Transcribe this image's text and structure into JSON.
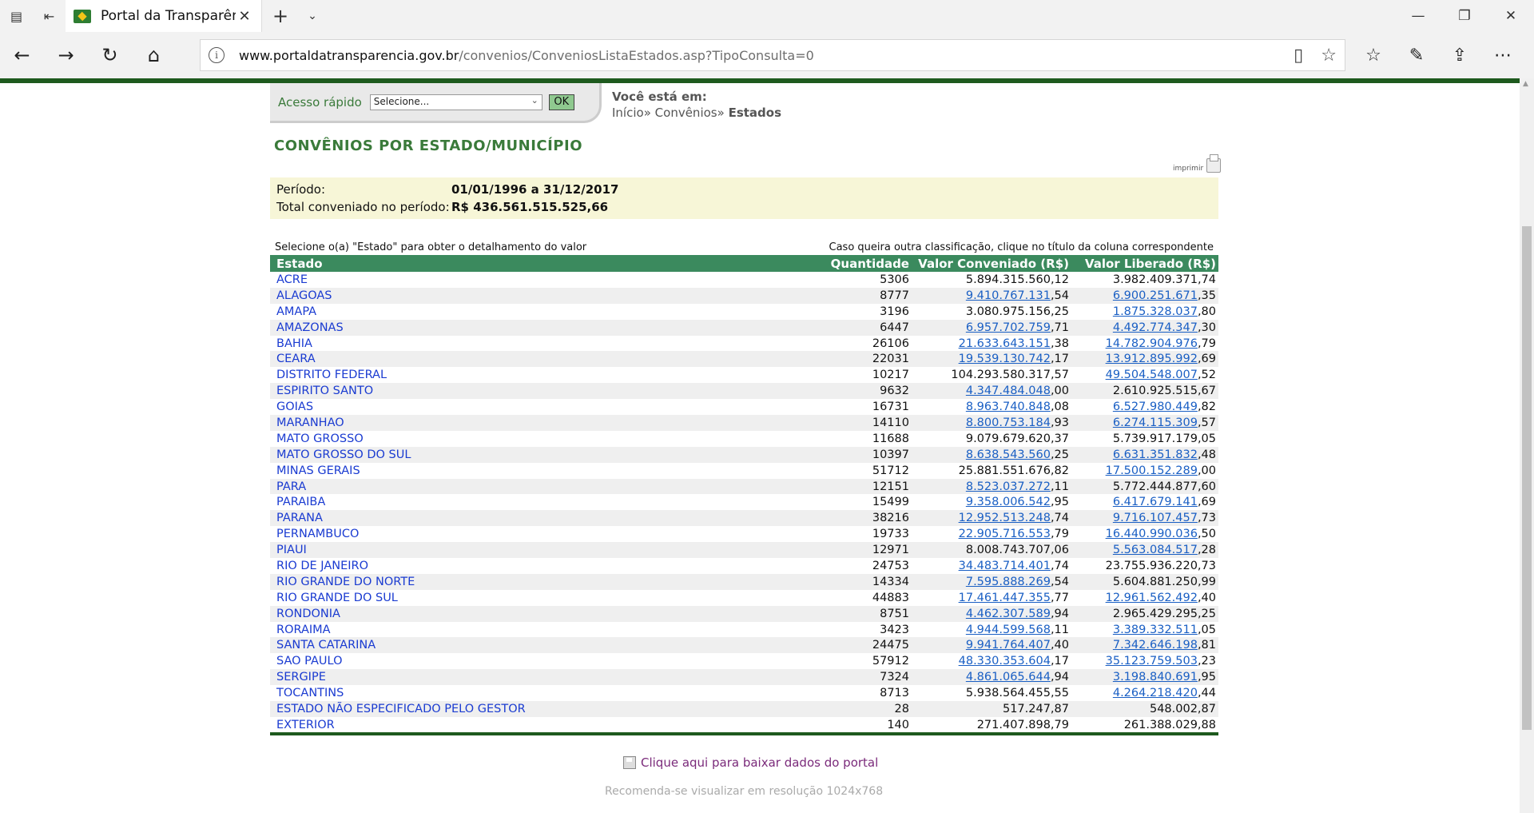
{
  "browser": {
    "tab_title": "Portal da Transparência",
    "url_host": "www.portaldatransparencia.gov.br",
    "url_path": "/convenios/ConveniosListaEstados.asp?TipoConsulta=0",
    "icons": [
      "tab-actions-icon",
      "back-tabs-icon",
      "close-icon",
      "new-tab-icon",
      "tab-list-icon",
      "back-icon",
      "forward-icon",
      "refresh-icon",
      "home-icon",
      "info-icon",
      "reading-view-icon",
      "favorite-star-icon",
      "favorites-hub-icon",
      "pen-icon",
      "share-icon",
      "more-icon"
    ]
  },
  "quick_access": {
    "label": "Acesso rápido",
    "select_value": "Selecione...",
    "ok_label": "OK"
  },
  "breadcrumb": {
    "label": "Você está em:",
    "home": "Início",
    "sep1": "»",
    "convenios": "Convênios",
    "sep2": "»",
    "current": "Estados"
  },
  "page_title": "CONVÊNIOS POR ESTADO/MUNICÍPIO",
  "print_label": "imprimir",
  "period": {
    "label": "Período:",
    "value": "01/01/1996 a 31/12/2017",
    "total_label": "Total conveniado no período:",
    "total_value": "R$ 436.561.515.525,66"
  },
  "hint_left": "Selecione o(a) \"Estado\" para obter o detalhamento do valor",
  "hint_right": "Caso queira outra classificação, clique no título da coluna correspondente",
  "table": {
    "headers": [
      "Estado",
      "Quantidade",
      "Valor Conveniado (R$)",
      "Valor Liberado (R$)"
    ],
    "rows": [
      [
        "ACRE",
        "5306",
        "5.894.315.560,12",
        "3.982.409.371,74"
      ],
      [
        "ALAGOAS",
        "8777",
        "9.410.767.131,54",
        "6.900.251.671,35"
      ],
      [
        "AMAPA",
        "3196",
        "3.080.975.156,25",
        "1.875.328.037,80"
      ],
      [
        "AMAZONAS",
        "6447",
        "6.957.702.759,71",
        "4.492.774.347,30"
      ],
      [
        "BAHIA",
        "26106",
        "21.633.643.151,38",
        "14.782.904.976,79"
      ],
      [
        "CEARA",
        "22031",
        "19.539.130.742,17",
        "13.912.895.992,69"
      ],
      [
        "DISTRITO FEDERAL",
        "10217",
        "104.293.580.317,57",
        "49.504.548.007,52"
      ],
      [
        "ESPIRITO SANTO",
        "9632",
        "4.347.484.048,00",
        "2.610.925.515,67"
      ],
      [
        "GOIAS",
        "16731",
        "8.963.740.848,08",
        "6.527.980.449,82"
      ],
      [
        "MARANHAO",
        "14110",
        "8.800.753.184,93",
        "6.274.115.309,57"
      ],
      [
        "MATO GROSSO",
        "11688",
        "9.079.679.620,37",
        "5.739.917.179,05"
      ],
      [
        "MATO GROSSO DO SUL",
        "10397",
        "8.638.543.560,25",
        "6.631.351.832,48"
      ],
      [
        "MINAS GERAIS",
        "51712",
        "25.881.551.676,82",
        "17.500.152.289,00"
      ],
      [
        "PARA",
        "12151",
        "8.523.037.272,11",
        "5.772.444.877,60"
      ],
      [
        "PARAIBA",
        "15499",
        "9.358.006.542,95",
        "6.417.679.141,69"
      ],
      [
        "PARANA",
        "38216",
        "12.952.513.248,74",
        "9.716.107.457,73"
      ],
      [
        "PERNAMBUCO",
        "19733",
        "22.905.716.553,79",
        "16.440.990.036,50"
      ],
      [
        "PIAUI",
        "12971",
        "8.008.743.707,06",
        "5.563.084.517,28"
      ],
      [
        "RIO DE JANEIRO",
        "24753",
        "34.483.714.401,74",
        "23.755.936.220,73"
      ],
      [
        "RIO GRANDE DO NORTE",
        "14334",
        "7.595.888.269,54",
        "5.604.881.250,99"
      ],
      [
        "RIO GRANDE DO SUL",
        "44883",
        "17.461.447.355,77",
        "12.961.562.492,40"
      ],
      [
        "RONDONIA",
        "8751",
        "4.462.307.589,94",
        "2.965.429.295,25"
      ],
      [
        "RORAIMA",
        "3423",
        "4.944.599.568,11",
        "3.389.332.511,05"
      ],
      [
        "SANTA CATARINA",
        "24475",
        "9.941.764.407,40",
        "7.342.646.198,81"
      ],
      [
        "SAO PAULO",
        "57912",
        "48.330.353.604,17",
        "35.123.759.503,23"
      ],
      [
        "SERGIPE",
        "7324",
        "4.861.065.644,94",
        "3.198.840.691,95"
      ],
      [
        "TOCANTINS",
        "8713",
        "5.938.564.455,55",
        "4.264.218.420,44"
      ],
      [
        "ESTADO NÃO ESPECIFICADO PELO GESTOR",
        "28",
        "517.247,87",
        "548.002,87"
      ],
      [
        "EXTERIOR",
        "140",
        "271.407.898,79",
        "261.388.029,88"
      ]
    ],
    "linked_conveniado": [
      false,
      true,
      false,
      true,
      true,
      true,
      false,
      true,
      true,
      true,
      false,
      true,
      false,
      true,
      true,
      true,
      true,
      false,
      true,
      true,
      true,
      true,
      true,
      true,
      true,
      true,
      false,
      false,
      false
    ],
    "linked_liberado": [
      false,
      true,
      true,
      true,
      true,
      true,
      true,
      false,
      true,
      true,
      false,
      true,
      true,
      false,
      true,
      true,
      true,
      true,
      false,
      false,
      true,
      false,
      true,
      true,
      true,
      true,
      true,
      false,
      false
    ]
  },
  "download_label": "Clique aqui para baixar dados do portal",
  "recommend": "Recomenda-se visualizar em resolução 1024x768",
  "colors": {
    "header_green": "#3b8a5e",
    "title_green": "#3a7a3a",
    "estado_link": "#1a3bd1",
    "value_link": "#1a5fc4",
    "period_bg": "#f7f6d7"
  }
}
